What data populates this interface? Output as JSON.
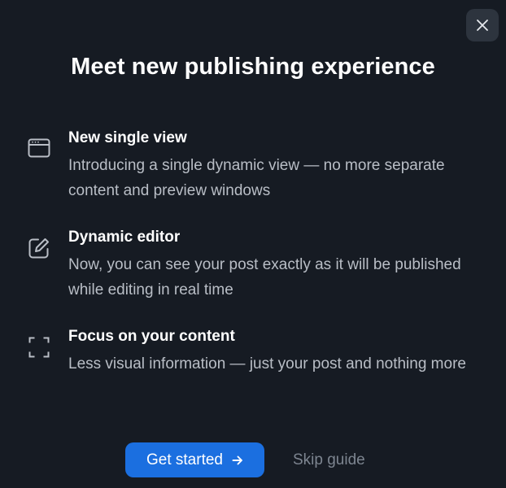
{
  "dialog": {
    "title": "Meet new publishing experience",
    "close_icon": "close-icon",
    "features": [
      {
        "icon": "browser-window-icon",
        "title": "New single view",
        "description": "Introducing a single dynamic view — no more separate content and preview windows"
      },
      {
        "icon": "edit-pencil-icon",
        "title": "Dynamic editor",
        "description": "Now, you can see your post exactly as it will be published while editing in real time"
      },
      {
        "icon": "focus-frame-icon",
        "title": "Focus on your content",
        "description": "Less visual information — just your post and nothing more"
      }
    ],
    "primary_button": {
      "label": "Get started",
      "icon": "arrow-right-icon"
    },
    "secondary_link": {
      "label": "Skip guide"
    }
  },
  "colors": {
    "background": "#161b23",
    "primary": "#1b6fe0",
    "close_button_bg": "#2d343e",
    "text": "#ffffff",
    "muted_text": "#b9bec6",
    "link_text": "#7d8590"
  }
}
